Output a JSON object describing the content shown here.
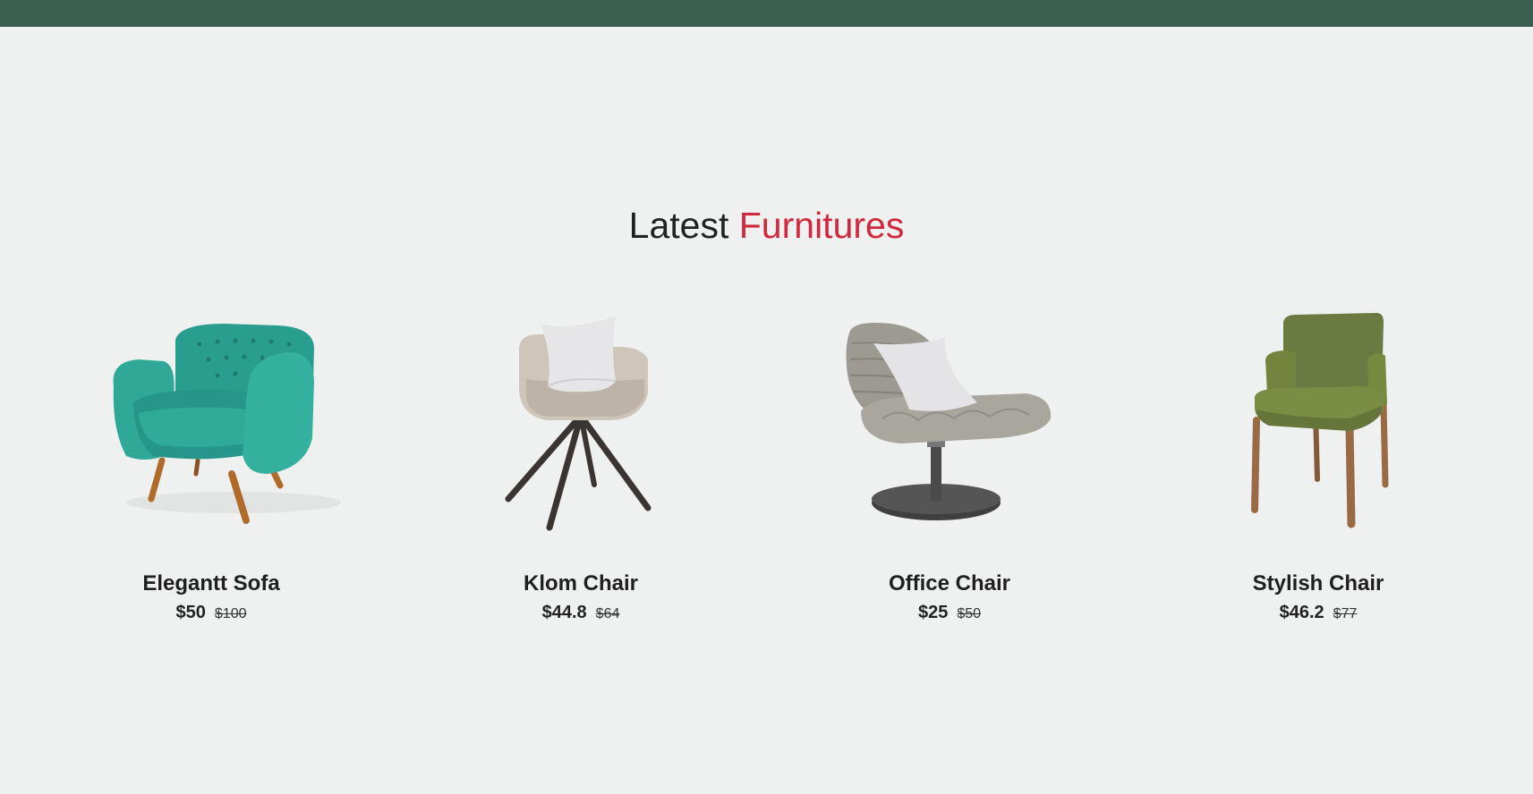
{
  "header": {
    "color": "#3b5e50"
  },
  "section": {
    "title_plain": "Latest",
    "title_accent": "Furnitures",
    "accent_color": "#d2283e"
  },
  "products": [
    {
      "name": "Elegantt Sofa",
      "price": "$50",
      "old_price": "$100",
      "image_icon": "teal-armchair-image"
    },
    {
      "name": "Klom Chair",
      "price": "$44.8",
      "old_price": "$64",
      "image_icon": "beige-swivel-chair-image"
    },
    {
      "name": "Office Chair",
      "price": "$25",
      "old_price": "$50",
      "image_icon": "grey-lounge-chair-image"
    },
    {
      "name": "Stylish Chair",
      "price": "$46.2",
      "old_price": "$77",
      "image_icon": "green-dining-chair-image"
    }
  ]
}
